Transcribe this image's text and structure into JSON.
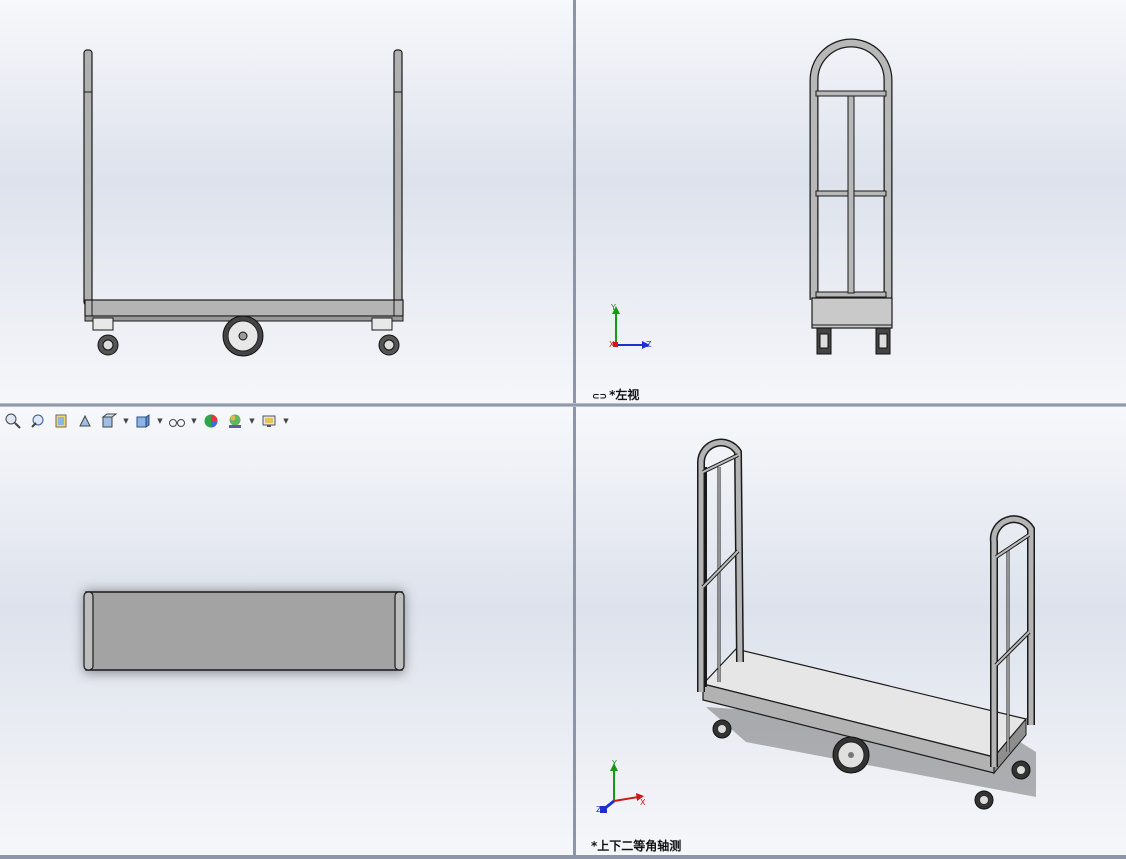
{
  "viewports": {
    "front": {
      "label": ""
    },
    "left": {
      "label": "*左视"
    },
    "top": {
      "label": ""
    },
    "isometric": {
      "label": "*上下二等角轴测"
    }
  },
  "triad": {
    "left_view": {
      "y": "Y",
      "x": "X",
      "z": "Z"
    },
    "iso_view": {
      "y": "Y",
      "x": "X",
      "z": "Z"
    }
  },
  "heads_up_toolbar": [
    {
      "icon": "zoom-to-fit-icon",
      "dropdown": false
    },
    {
      "icon": "zoom-to-area-icon",
      "dropdown": false
    },
    {
      "icon": "previous-view-icon",
      "dropdown": false
    },
    {
      "icon": "section-view-icon",
      "dropdown": false
    },
    {
      "icon": "view-orientation-icon",
      "dropdown": true
    },
    {
      "icon": "display-style-icon",
      "dropdown": true
    },
    {
      "icon": "hide-show-items-icon",
      "dropdown": true
    },
    {
      "icon": "edit-appearance-icon",
      "dropdown": false
    },
    {
      "icon": "apply-scene-icon",
      "dropdown": true
    },
    {
      "icon": "view-settings-icon",
      "dropdown": true
    }
  ],
  "colors": {
    "steel": "#a9a9a9",
    "deck": "#e6e6e6",
    "outline": "#1a1a1a",
    "axis_x": "#d01818",
    "axis_y": "#159a15",
    "axis_z": "#1e2fd0"
  }
}
